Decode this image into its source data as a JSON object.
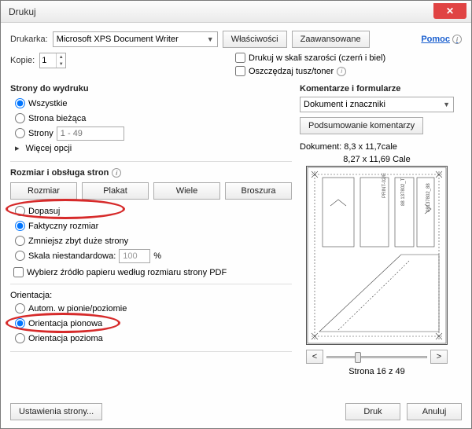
{
  "window": {
    "title": "Drukuj"
  },
  "top": {
    "printer_label": "Drukarka:",
    "printer_value": "Microsoft XPS Document Writer",
    "props_btn": "Właściwości",
    "adv_btn": "Zaawansowane",
    "help": "Pomoc"
  },
  "copies": {
    "label": "Kopie:",
    "value": "1"
  },
  "opts": {
    "grayscale": "Drukuj w skali szarości (czerń i biel)",
    "save_ink": "Oszczędzaj tusz/toner"
  },
  "pages": {
    "header": "Strony do wydruku",
    "all": "Wszystkie",
    "current": "Strona bieżąca",
    "pages_label": "Strony",
    "pages_range": "1 - 49",
    "more": "Więcej opcji"
  },
  "size": {
    "header": "Rozmiar i obsługa stron",
    "btn_size": "Rozmiar",
    "btn_poster": "Plakat",
    "btn_multi": "Wiele",
    "btn_booklet": "Broszura",
    "fit": "Dopasuj",
    "actual": "Faktyczny rozmiar",
    "shrink": "Zmniejsz zbyt duże strony",
    "custom": "Skala niestandardowa:",
    "custom_val": "100",
    "pct": "%",
    "papersrc": "Wybierz źródło papieru według rozmiaru strony PDF"
  },
  "orient": {
    "header": "Orientacja:",
    "auto": "Autom. w pionie/poziomie",
    "portrait": "Orientacja pionowa",
    "landscape": "Orientacja pozioma"
  },
  "comments": {
    "header": "Komentarze i formularze",
    "value": "Dokument i znaczniki",
    "summary": "Podsumowanie komentarzy"
  },
  "preview": {
    "doc_label": "Dokument: 8,3 x 11,7cale",
    "sheet_label": "8,27 x 11,69 Cale",
    "prev": "<",
    "next": ">",
    "page_of": "Strona 16 z 49"
  },
  "bottom": {
    "page_setup": "Ustawienia strony...",
    "print": "Druk",
    "cancel": "Anuluj"
  }
}
